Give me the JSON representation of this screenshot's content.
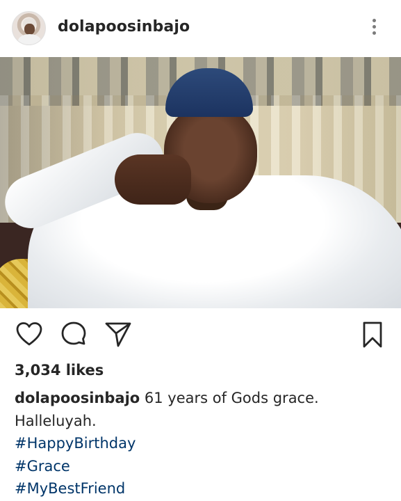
{
  "post": {
    "username": "dolapoosinbajo",
    "likes": "3,034 likes",
    "caption_user": "dolapoosinbajo",
    "caption_line1": " 61 years of Gods grace.",
    "caption_line2": "Halleluyah.",
    "hashtags": [
      "#HappyBirthday",
      "#Grace",
      "#MyBestFriend"
    ]
  },
  "icons": {
    "more": "more-options-icon",
    "like": "heart-icon",
    "comment": "comment-icon",
    "share": "paper-plane-icon",
    "save": "bookmark-icon"
  },
  "colors": {
    "text": "#262626",
    "hashtag": "#003569",
    "icon": "#262626"
  }
}
